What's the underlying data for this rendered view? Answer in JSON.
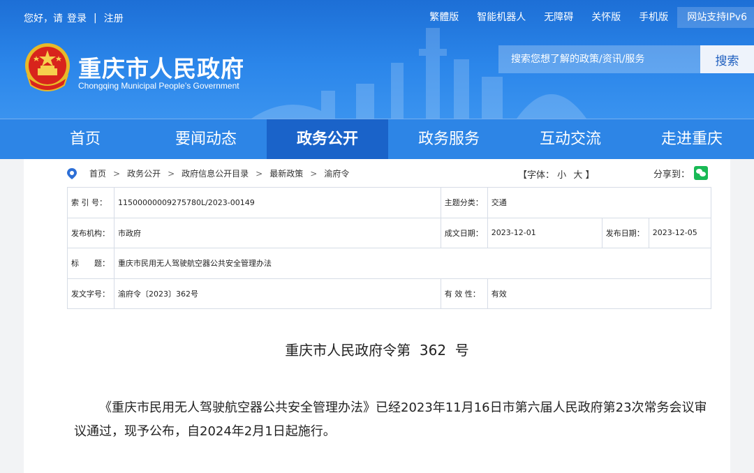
{
  "topbar": {
    "greeting": "您好，请",
    "login": "登录",
    "separator": "|",
    "register": "注册",
    "links": [
      "繁體版",
      "智能机器人",
      "无障碍",
      "关怀版",
      "手机版"
    ],
    "ipv6": "网站支持IPv6"
  },
  "header": {
    "title": "重庆市人民政府",
    "subtitle": "Chongqing Municipal People’s Government",
    "emblem_icon": "national-emblem-icon",
    "brand_color": "#2b86ea"
  },
  "search": {
    "placeholder": "搜索您想了解的政策/资讯/服务",
    "button": "搜索"
  },
  "nav": {
    "items": [
      "首页",
      "要闻动态",
      "政务公开",
      "政务服务",
      "互动交流",
      "走进重庆"
    ],
    "active": "政务公开"
  },
  "breadcrumb": {
    "items": [
      "首页",
      "政务公开",
      "政府信息公开目录",
      "最新政策",
      "渝府令"
    ],
    "separator": ">"
  },
  "font_size": {
    "label": "【字体：",
    "small": "小",
    "large": "大",
    "end": "】"
  },
  "share": {
    "label": "分享到：",
    "icon": "wechat-icon"
  },
  "meta": {
    "index_label": "索 引 号：",
    "index_value": "11500000009275780L/2023-00149",
    "topic_label": "主题分类：",
    "topic_value": "交通",
    "org_label": "发布机构：",
    "org_value": "市政府",
    "created_label": "成文日期：",
    "created_value": "2023-12-01",
    "published_label": "发布日期：",
    "published_value": "2023-12-05",
    "title_label": "标　　题：",
    "title_value": "重庆市民用无人驾驶航空器公共安全管理办法",
    "docno_label": "发文字号：",
    "docno_value": "渝府令〔2023〕362号",
    "valid_label": "有 效 性：",
    "valid_value": "有效"
  },
  "document": {
    "heading": "重庆市人民政府令第  362  号",
    "body": "《重庆市民用无人驾驶航空器公共安全管理办法》已经2023年11月16日市第六届人民政府第23次常务会议审议通过，现予公布，自2024年2月1日起施行。"
  }
}
